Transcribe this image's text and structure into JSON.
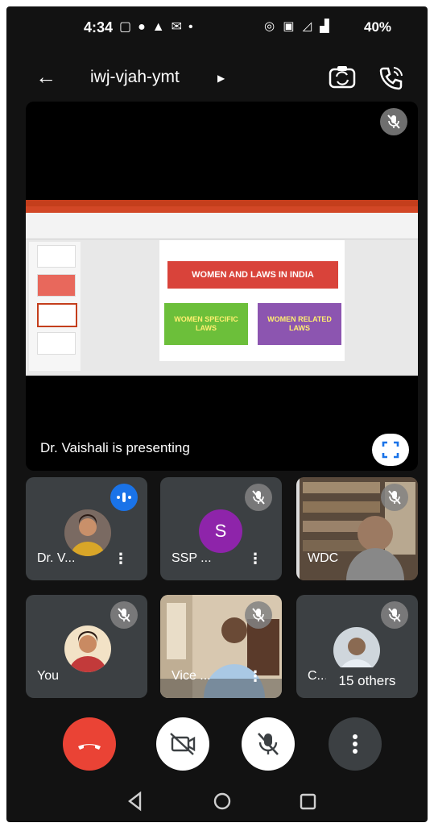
{
  "status_bar": {
    "time": "4:34",
    "battery": "40%"
  },
  "header": {
    "meeting_code": "iwj-vjah-ymt"
  },
  "presentation": {
    "presenting_text": "Dr. Vaishali is presenting",
    "slide": {
      "title_box": "WOMEN AND LAWS IN INDIA",
      "left_box": "WOMEN SPECIFIC LAWS",
      "right_box": "WOMEN RELATED LAWS"
    }
  },
  "participants": [
    {
      "name": "Dr. V...",
      "speaking": true
    },
    {
      "name": "SSP ...",
      "avatar_letter": "S",
      "muted": true
    },
    {
      "name": "WDC",
      "muted": true
    },
    {
      "name": "You",
      "muted": true
    },
    {
      "name": "Vice ...",
      "muted": true
    },
    {
      "name": "C...",
      "muted": true,
      "overflow_label": "15 others"
    }
  ],
  "colors": {
    "end_call": "#ea4335",
    "speaking_badge": "#1a73e8",
    "avatar_purple": "#8e24aa",
    "tile_bg": "#3c4043"
  },
  "icons": [
    "back-arrow-icon",
    "switch-camera-icon",
    "phone-audio-icon",
    "mic-off-icon",
    "fullscreen-icon",
    "more-options-icon",
    "end-call-icon",
    "camera-off-icon"
  ]
}
